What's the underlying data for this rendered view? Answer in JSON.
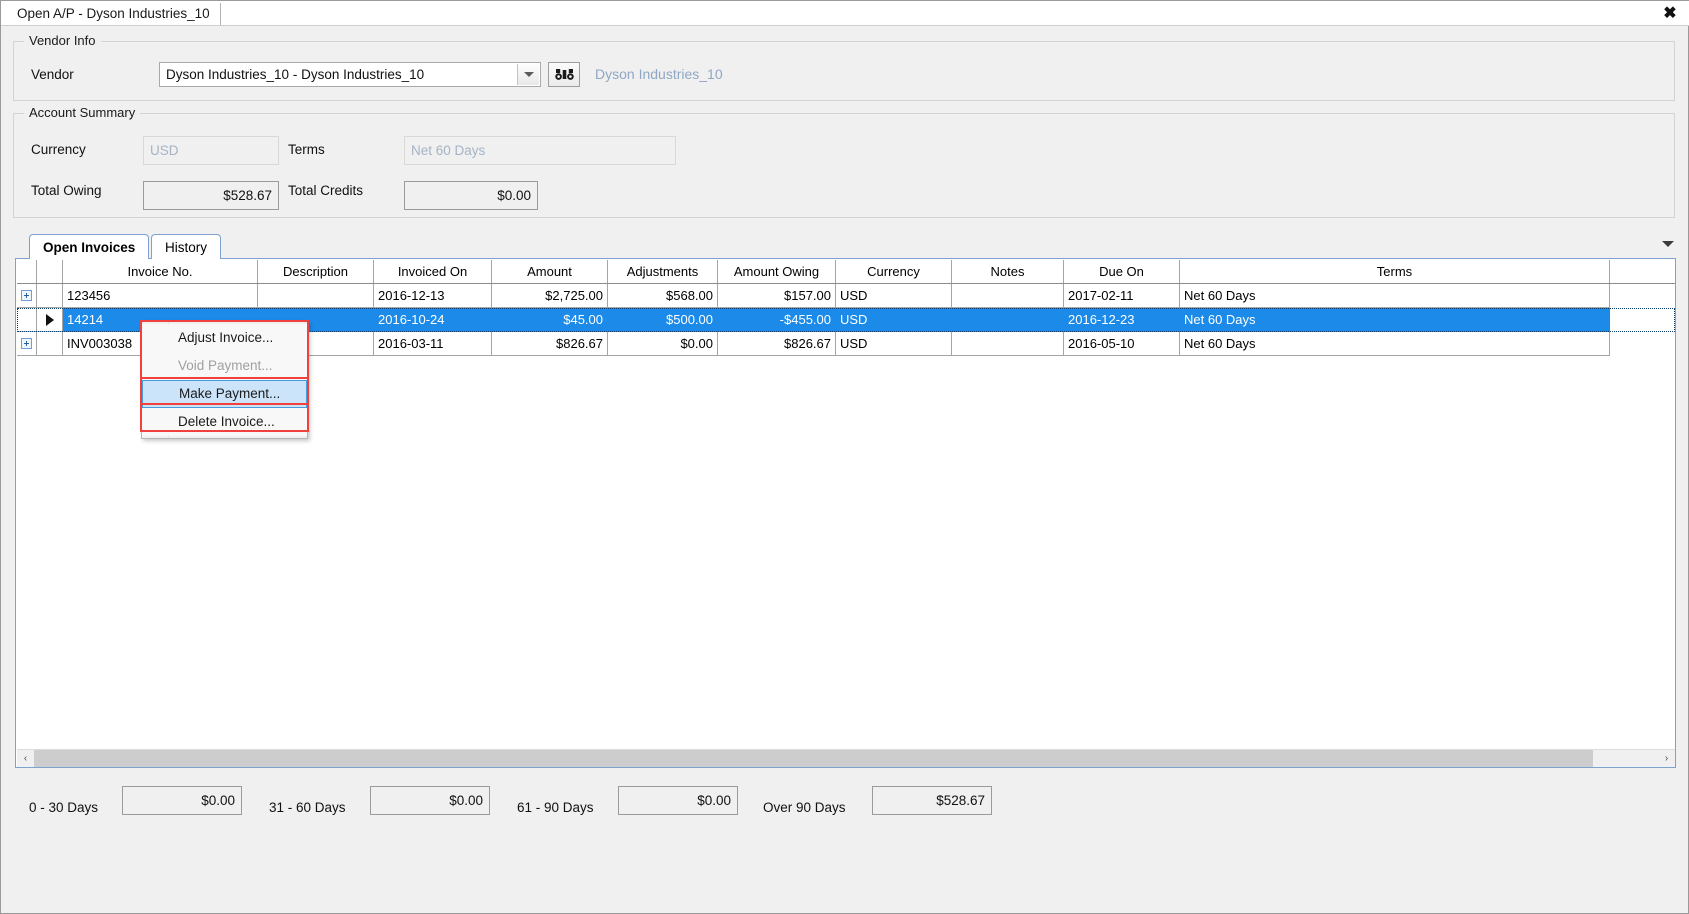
{
  "window": {
    "tab_title": "Open A/P - Dyson Industries_10",
    "close_label": "✖"
  },
  "vendor_info": {
    "legend": "Vendor Info",
    "vendor_label": "Vendor",
    "vendor_value": "Dyson Industries_10 - Dyson Industries_10",
    "search_icon": "binoculars-icon",
    "vendor_display_name": "Dyson Industries_10"
  },
  "account_summary": {
    "legend": "Account Summary",
    "currency_label": "Currency",
    "currency_value": "USD",
    "terms_label": "Terms",
    "terms_value": "Net 60 Days",
    "total_owing_label": "Total Owing",
    "total_owing_value": "$528.67",
    "total_credits_label": "Total Credits",
    "total_credits_value": "$0.00"
  },
  "tabs": [
    {
      "label": "Open Invoices",
      "active": true
    },
    {
      "label": "History",
      "active": false
    }
  ],
  "grid": {
    "columns": [
      "Invoice No.",
      "Description",
      "Invoiced On",
      "Amount",
      "Adjustments",
      "Amount Owing",
      "Currency",
      "Notes",
      "Due On",
      "Terms"
    ],
    "rows": [
      {
        "expander": "expand-icon",
        "selected": false,
        "invoice_no": "123456",
        "description": "",
        "invoiced_on": "2016-12-13",
        "amount": "$2,725.00",
        "adjustments": "$568.00",
        "amount_owing": "$157.00",
        "currency": "USD",
        "notes": "",
        "due_on": "2017-02-11",
        "terms": "Net 60 Days"
      },
      {
        "expander": "row-pointer-icon",
        "selected": true,
        "invoice_no": "14214",
        "description": "",
        "invoiced_on": "2016-10-24",
        "amount": "$45.00",
        "adjustments": "$500.00",
        "amount_owing": "-$455.00",
        "currency": "USD",
        "notes": "",
        "due_on": "2016-12-23",
        "terms": "Net 60 Days"
      },
      {
        "expander": "expand-icon",
        "selected": false,
        "invoice_no": "INV003038",
        "description": "",
        "invoiced_on": "2016-03-11",
        "amount": "$826.67",
        "adjustments": "$0.00",
        "amount_owing": "$826.67",
        "currency": "USD",
        "notes": "",
        "due_on": "2016-05-10",
        "terms": "Net 60 Days"
      }
    ]
  },
  "context_menu": {
    "items": [
      {
        "label": "Adjust Invoice...",
        "state": "enabled"
      },
      {
        "label": "Void Payment...",
        "state": "disabled"
      },
      {
        "label": "Make Payment...",
        "state": "highlighted"
      },
      {
        "label": "Delete Invoice...",
        "state": "enabled"
      }
    ],
    "highlight_color": "#f1413c"
  },
  "aging": [
    {
      "label": "0 - 30 Days",
      "value": "$0.00"
    },
    {
      "label": "31 - 60 Days",
      "value": "$0.00"
    },
    {
      "label": "61 - 90 Days",
      "value": "$0.00"
    },
    {
      "label": "Over 90 Days",
      "value": "$528.67"
    }
  ],
  "scrollbar": {
    "left_arrow": "‹",
    "right_arrow": "›"
  }
}
